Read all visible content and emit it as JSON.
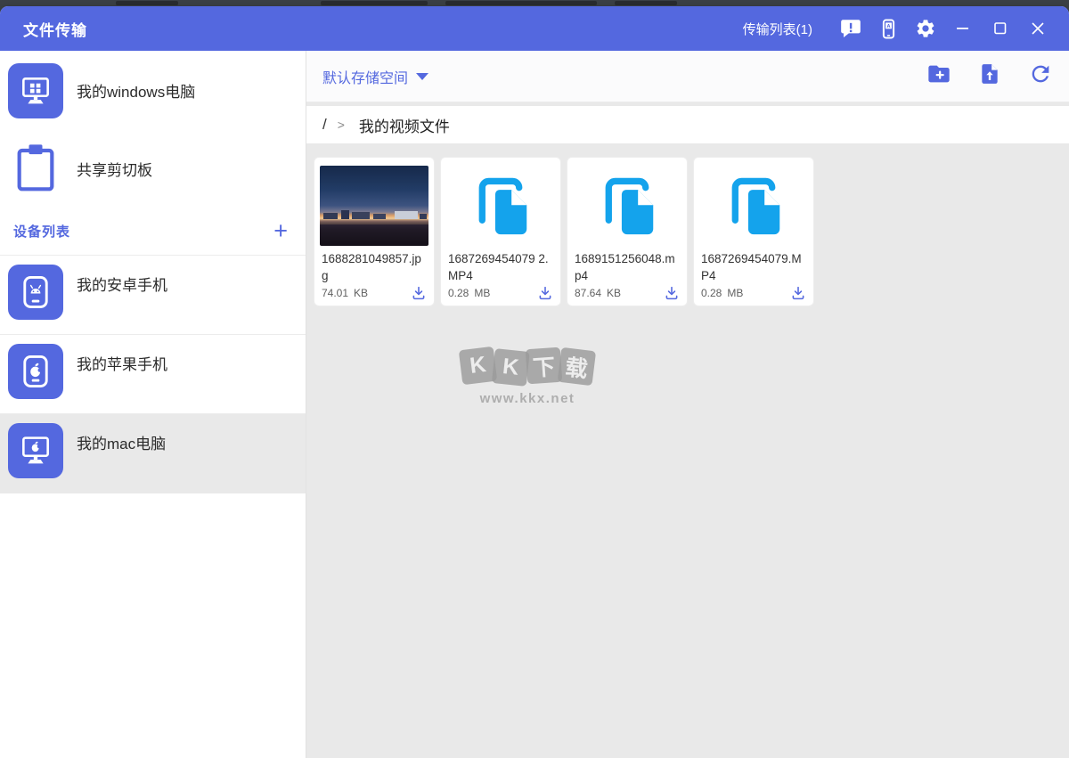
{
  "window": {
    "title": "文件传输"
  },
  "titlebar": {
    "transfer_list_label": "传输列表(1)",
    "icons": {
      "feedback": "speech-bubble-exclamation",
      "device": "phone-letter-a",
      "settings": "gear",
      "minimize": "minimize-dash",
      "maximize": "maximize-square",
      "close": "close-x"
    }
  },
  "sidebar": {
    "items": [
      {
        "label": "我的windows电脑",
        "icon": "windows-computer"
      },
      {
        "label": "共享剪切板",
        "icon": "clipboard"
      }
    ],
    "device_section": {
      "title": "设备列表",
      "add_button": "+"
    },
    "devices": [
      {
        "label": "我的安卓手机",
        "icon": "android-phone",
        "selected": false
      },
      {
        "label": "我的苹果手机",
        "icon": "apple-phone",
        "selected": false
      },
      {
        "label": "我的mac电脑",
        "icon": "mac-computer",
        "selected": true
      }
    ]
  },
  "main": {
    "storage_dropdown": {
      "label": "默认存储空间"
    },
    "toolbar_icons": {
      "new_folder": "folder-plus",
      "upload_file": "file-upload-arrow",
      "refresh": "refresh-arrow"
    },
    "breadcrumb": {
      "root": "/",
      "separator": ">",
      "current": "我的视频文件"
    },
    "files": [
      {
        "name": "1688281049857.jpg",
        "size_value": "74.01",
        "size_unit": "KB",
        "kind": "image-thumbnail"
      },
      {
        "name": "1687269454079 2.MP4",
        "size_value": "0.28",
        "size_unit": "MB",
        "kind": "file-icon"
      },
      {
        "name": "1689151256048.mp4",
        "size_value": "87.64",
        "size_unit": "KB",
        "kind": "file-icon"
      },
      {
        "name": "1687269454079.MP4",
        "size_value": "0.28",
        "size_unit": "MB",
        "kind": "file-icon"
      }
    ]
  },
  "watermark": {
    "logo_chars": [
      "K",
      "K",
      "下",
      "载"
    ],
    "url": "www.kkx.net"
  },
  "colors": {
    "accent": "#5468df",
    "titlebar": "#5468df",
    "file_icon_blue": "#14a3ec",
    "content_bg": "#e9e9e9",
    "selected_item_bg": "#e9e9e9"
  }
}
